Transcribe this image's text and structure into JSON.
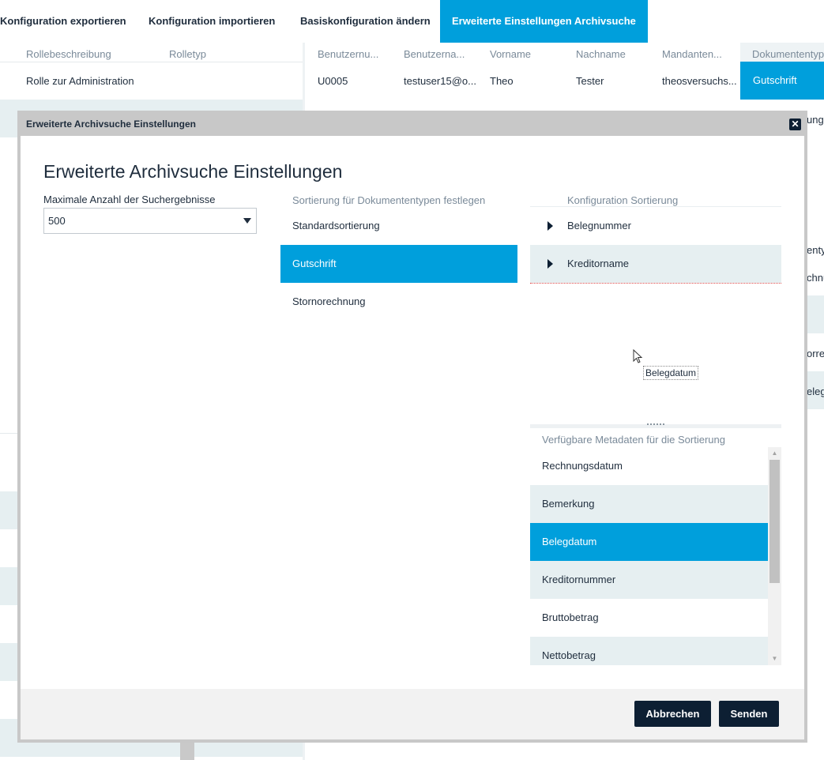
{
  "topnav": {
    "tabs": [
      {
        "label": "Konfiguration exportieren"
      },
      {
        "label": "Konfiguration importieren"
      },
      {
        "label": "Basiskonfiguration ändern"
      },
      {
        "label": "Erweiterte Einstellungen Archivsuche",
        "active": true
      }
    ]
  },
  "roles_table": {
    "headers": [
      "Rollebeschreibung",
      "Rolletyp"
    ],
    "rows": [
      [
        "Rolle zur Administration",
        ""
      ]
    ]
  },
  "users_table": {
    "headers": [
      "Benutzernu...",
      "Benutzerna...",
      "Vorname",
      "Nachname",
      "Mandanten..."
    ],
    "rows": [
      [
        "U0005",
        "testuser15@o...",
        "Theo",
        "Tester",
        "theosversuchs..."
      ]
    ]
  },
  "doctype_table": {
    "header": "Dokumententyp",
    "selected": "Gutschrift",
    "peek_items": [
      "ung",
      "entyp",
      "chnu",
      "orre",
      "eleg"
    ]
  },
  "modal": {
    "titlebar": "Erweiterte Archivsuche Einstellungen",
    "title": "Erweiterte Archivsuche Einstellungen",
    "max_results": {
      "label": "Maximale Anzahl der Suchergebnisse",
      "value": "500"
    },
    "doctypes": {
      "header": "Sortierung für Dokumententypen festlegen",
      "items": [
        {
          "label": "Standardsortierung"
        },
        {
          "label": "Gutschrift",
          "selected": true
        },
        {
          "label": "Stornorechnung"
        }
      ]
    },
    "sort_config": {
      "header": "Konfiguration Sortierung",
      "items": [
        {
          "label": "Belegnummer"
        },
        {
          "label": "Kreditorname"
        }
      ]
    },
    "drag_ghost": "Belegdatum",
    "available": {
      "header": "Verfügbare Metadaten für die Sortierung",
      "items": [
        {
          "label": "Rechnungsdatum"
        },
        {
          "label": "Bemerkung"
        },
        {
          "label": "Belegdatum",
          "selected": true
        },
        {
          "label": "Kreditornummer"
        },
        {
          "label": "Bruttobetrag"
        },
        {
          "label": "Nettobetrag"
        }
      ]
    },
    "buttons": {
      "cancel": "Abbrechen",
      "submit": "Senden"
    }
  },
  "colors": {
    "accent": "#009fdc",
    "dark": "#0d1f33",
    "stripe": "#e6eff1"
  }
}
